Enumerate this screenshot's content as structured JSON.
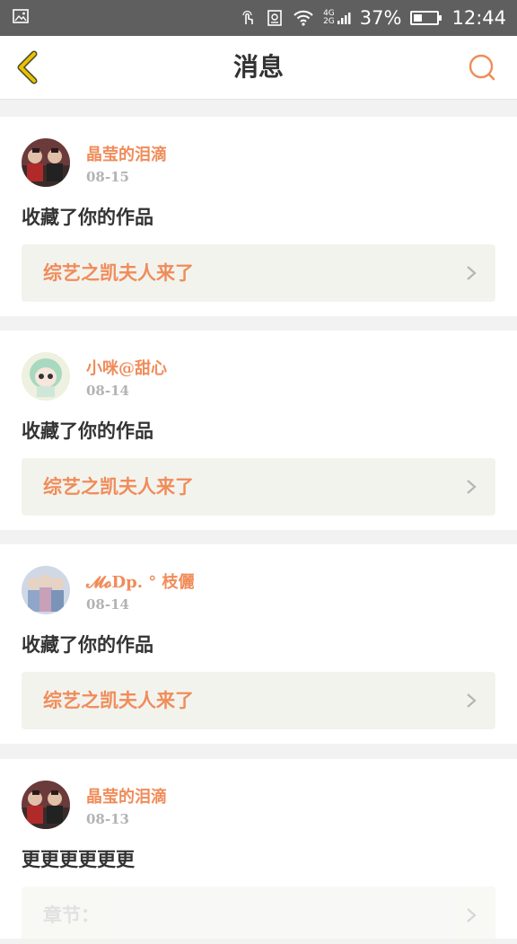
{
  "status": {
    "battery": "37%",
    "battery_level": 0.37,
    "time": "12:44",
    "net_top": "4G",
    "net_bottom": "2G"
  },
  "header": {
    "title": "消息"
  },
  "messages": [
    {
      "user": "晶莹的泪滴",
      "date": "08-15",
      "action": "收藏了你的作品",
      "work": "综艺之凯夫人来了"
    },
    {
      "user": "小咪@甜心",
      "date": "08-14",
      "action": "收藏了你的作品",
      "work": "综艺之凯夫人来了"
    },
    {
      "user": "𝓜𝓸Dp. ° 枝儷",
      "date": "08-14",
      "action": "收藏了你的作品",
      "work": "综艺之凯夫人来了"
    },
    {
      "user": "晶莹的泪滴",
      "date": "08-13",
      "action": "更更更更更更",
      "work": "章节："
    }
  ],
  "colors": {
    "accent": "#f08c5a",
    "back_arrow": "#e8c200",
    "status_bar": "#5f5f5f"
  }
}
